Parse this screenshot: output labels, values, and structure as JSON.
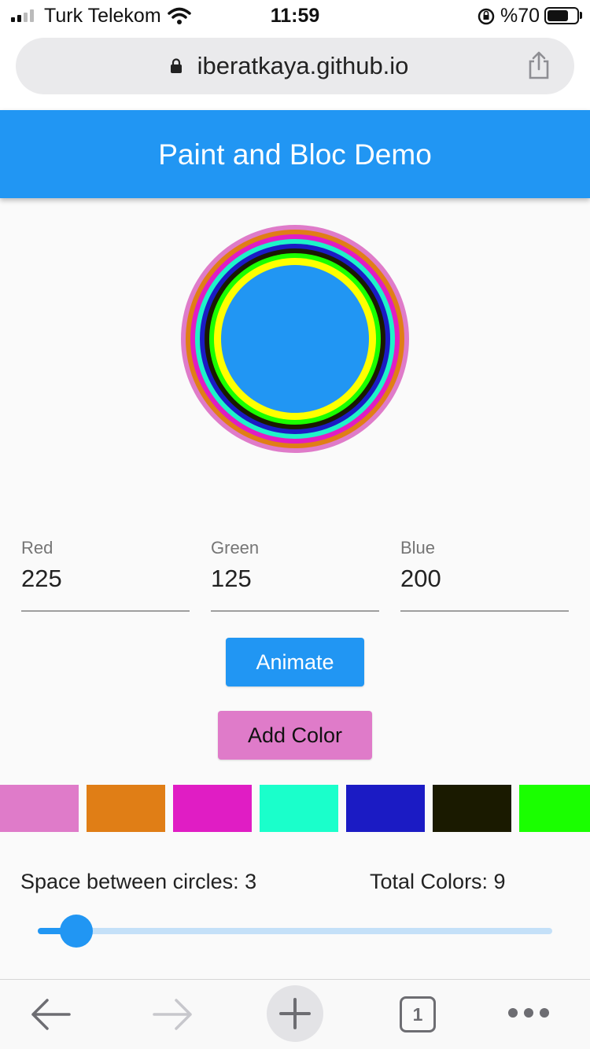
{
  "status_bar": {
    "carrier": "Turk Telekom",
    "time": "11:59",
    "battery_pct": "%70",
    "icons": [
      "signal-icon",
      "wifi-icon",
      "rotation-lock-icon",
      "battery-icon"
    ]
  },
  "browser": {
    "url": "iberatkaya.github.io",
    "icons": [
      "lock-icon",
      "share-icon"
    ]
  },
  "app_bar": {
    "title": "Paint and Bloc Demo"
  },
  "circle": {
    "center_color": "#2196f3",
    "ring_colors": [
      "#df7bc9",
      "#e07e16",
      "#e01dc4",
      "#1ef3c9",
      "#1b1bc4",
      "#1a1a00",
      "#1aff00",
      "#ffff00"
    ]
  },
  "inputs": {
    "red": {
      "label": "Red",
      "value": "225"
    },
    "green": {
      "label": "Green",
      "value": "125"
    },
    "blue": {
      "label": "Blue",
      "value": "200"
    }
  },
  "buttons": {
    "animate": "Animate",
    "add_color": "Add Color"
  },
  "swatches": [
    "#df7bc9",
    "#e07e16",
    "#e01dc4",
    "#1affcb",
    "#1b1bc4",
    "#1a1a00",
    "#1aff00"
  ],
  "stats": {
    "space_label": "Space between circles: 3",
    "total_label": "Total Colors: 9"
  },
  "slider": {
    "value": 3,
    "min": 0,
    "max": 40
  },
  "toolbar": {
    "tab_count": "1",
    "icons": [
      "back-arrow-icon",
      "forward-arrow-icon",
      "new-tab-plus-icon",
      "tabs-count-icon",
      "more-dots-icon"
    ]
  },
  "colors": {
    "primary": "#2196f3",
    "accent_pink": "#df7bc9"
  }
}
